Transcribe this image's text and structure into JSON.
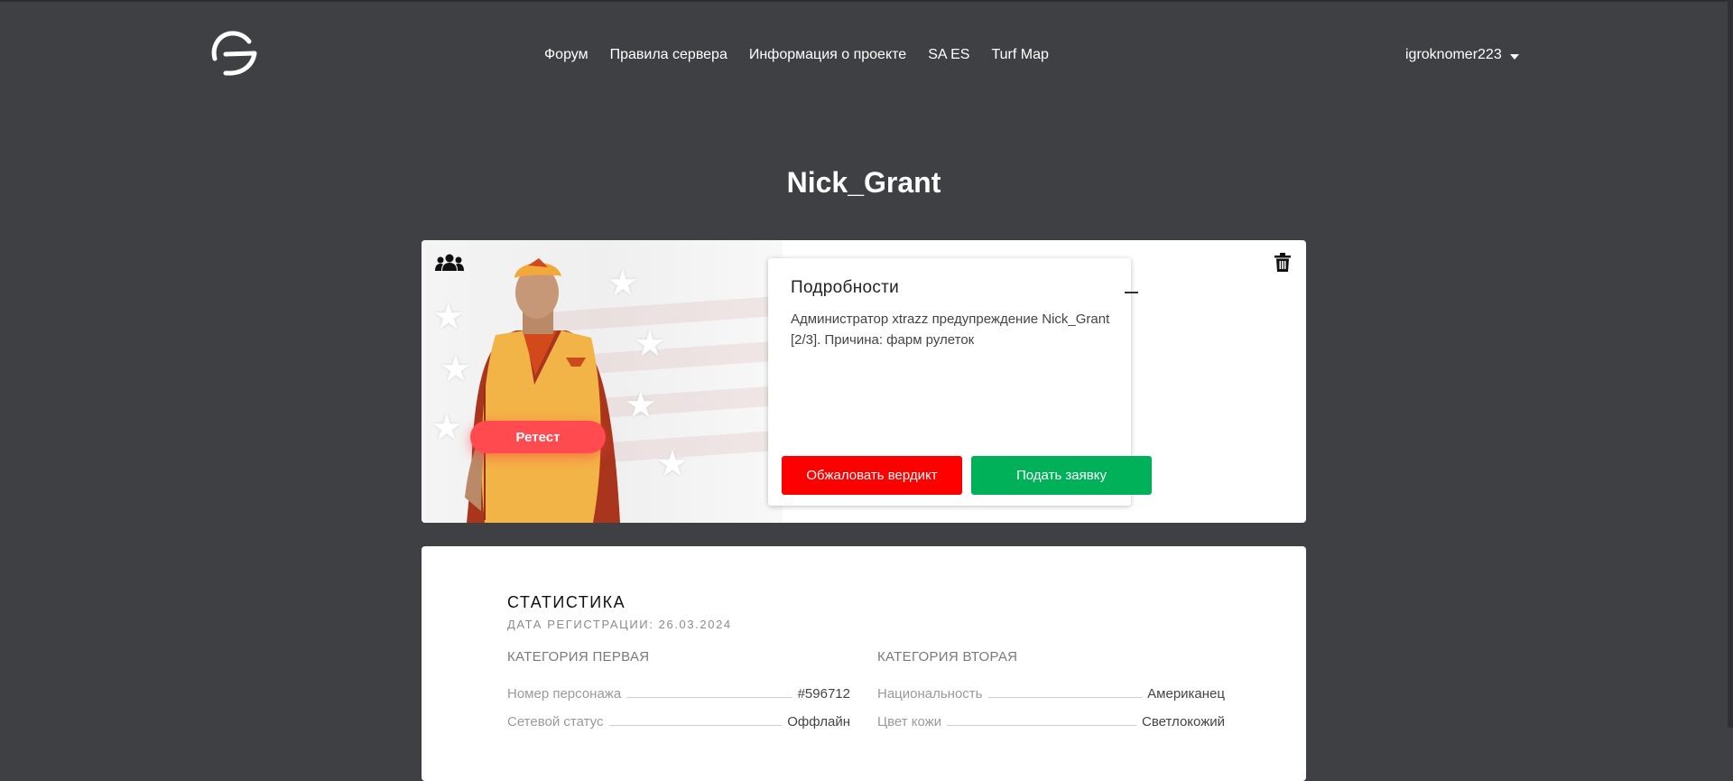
{
  "nav": {
    "items": [
      "Форум",
      "Правила сервера",
      "Информация о проекте",
      "SA ES",
      "Turf Map"
    ],
    "username": "igroknomer223"
  },
  "profile": {
    "name": "Nick_Grant",
    "retest_label": "Ретест",
    "details": {
      "title": "Подробности",
      "text": "Администратор xtrazz предупреждение Nick_Grant [2/3]. Причина: фарм рулеток",
      "appeal_label": "Обжаловать вердикт",
      "apply_label": "Подать заявку"
    }
  },
  "stats": {
    "title": "СТАТИСТИКА",
    "registration": "ДАТА РЕГИСТРАЦИИ: 26.03.2024",
    "category1": {
      "title": "КАТЕГОРИЯ ПЕРВАЯ",
      "rows": [
        {
          "label": "Номер персонажа",
          "value": "#596712"
        },
        {
          "label": "Сетевой статус",
          "value": "Оффлайн"
        }
      ]
    },
    "category2": {
      "title": "КАТЕГОРИЯ ВТОРАЯ",
      "rows": [
        {
          "label": "Национальность",
          "value": "Американец"
        },
        {
          "label": "Цвет кожи",
          "value": "Светлокожий"
        }
      ]
    }
  },
  "colors": {
    "background": "#3f4043",
    "retest": "#ff4a4f",
    "appeal": "#ff0000",
    "apply": "#00b15a"
  },
  "icons": [
    "logo-icon",
    "group-icon",
    "trash-icon",
    "chevron-down-icon",
    "minus-icon"
  ]
}
